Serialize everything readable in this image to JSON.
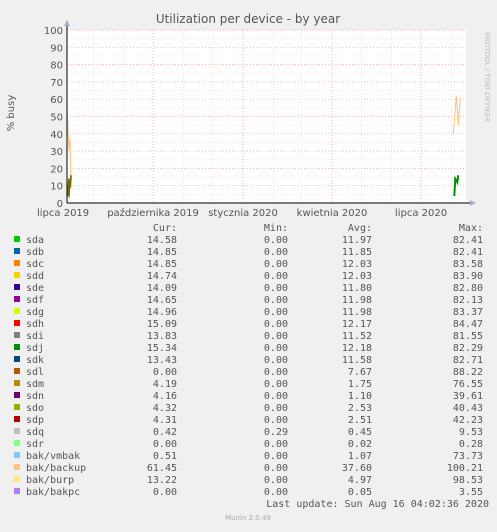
{
  "chart_data": {
    "type": "line",
    "title": "Utilization per device - by year",
    "ylabel": "% busy",
    "side_label": "RRDTOOL / TOBI OETIKER",
    "ylim": [
      0,
      100
    ],
    "yticks": [
      0,
      10,
      20,
      30,
      40,
      50,
      60,
      70,
      80,
      90,
      100
    ],
    "xlim": [
      "2019-07-05",
      "2020-08-16"
    ],
    "xticks": [
      {
        "label": "lipca 2019",
        "date": "2019-07-01"
      },
      {
        "label": "października 2019",
        "date": "2019-10-01"
      },
      {
        "label": "stycznia 2020",
        "date": "2020-01-01"
      },
      {
        "label": "kwietnia 2020",
        "date": "2020-04-01"
      },
      {
        "label": "lipca 2020",
        "date": "2020-07-01"
      }
    ],
    "grid": true,
    "columns": [
      "Cur:",
      "Min:",
      "Avg:",
      "Max:"
    ],
    "series": [
      {
        "name": "sda",
        "color": "#00cc00",
        "cur": "14.58",
        "min": "0.00",
        "avg": "11.97",
        "max": "82.41"
      },
      {
        "name": "sdb",
        "color": "#0066b3",
        "cur": "14.85",
        "min": "0.00",
        "avg": "11.85",
        "max": "82.41"
      },
      {
        "name": "sdc",
        "color": "#ff8000",
        "cur": "14.85",
        "min": "0.00",
        "avg": "12.03",
        "max": "83.58"
      },
      {
        "name": "sdd",
        "color": "#ffcc00",
        "cur": "14.74",
        "min": "0.00",
        "avg": "12.03",
        "max": "83.90"
      },
      {
        "name": "sde",
        "color": "#330099",
        "cur": "14.09",
        "min": "0.00",
        "avg": "11.80",
        "max": "82.80"
      },
      {
        "name": "sdf",
        "color": "#990099",
        "cur": "14.65",
        "min": "0.00",
        "avg": "11.98",
        "max": "82.13"
      },
      {
        "name": "sdg",
        "color": "#ccff00",
        "cur": "14.96",
        "min": "0.00",
        "avg": "11.98",
        "max": "83.37"
      },
      {
        "name": "sdh",
        "color": "#ff0000",
        "cur": "15.09",
        "min": "0.00",
        "avg": "12.17",
        "max": "84.47"
      },
      {
        "name": "sdi",
        "color": "#808080",
        "cur": "13.83",
        "min": "0.00",
        "avg": "11.52",
        "max": "81.55"
      },
      {
        "name": "sdj",
        "color": "#008f00",
        "cur": "15.34",
        "min": "0.00",
        "avg": "12.18",
        "max": "82.29"
      },
      {
        "name": "sdk",
        "color": "#00487d",
        "cur": "13.43",
        "min": "0.00",
        "avg": "11.58",
        "max": "82.71"
      },
      {
        "name": "sdl",
        "color": "#b35a00",
        "cur": "0.00",
        "min": "0.00",
        "avg": "7.67",
        "max": "88.22"
      },
      {
        "name": "sdm",
        "color": "#b38f00",
        "cur": "4.19",
        "min": "0.00",
        "avg": "1.75",
        "max": "76.55"
      },
      {
        "name": "sdn",
        "color": "#6b006b",
        "cur": "4.16",
        "min": "0.00",
        "avg": "1.10",
        "max": "39.61"
      },
      {
        "name": "sdo",
        "color": "#8fb300",
        "cur": "4.32",
        "min": "0.00",
        "avg": "2.53",
        "max": "40.43"
      },
      {
        "name": "sdp",
        "color": "#b30000",
        "cur": "4.31",
        "min": "0.00",
        "avg": "2.51",
        "max": "42.23"
      },
      {
        "name": "sdq",
        "color": "#bebebe",
        "cur": "0.42",
        "min": "0.29",
        "avg": "0.45",
        "max": "9.53"
      },
      {
        "name": "sdr",
        "color": "#80ff80",
        "cur": "0.00",
        "min": "0.00",
        "avg": "0.02",
        "max": "0.28"
      },
      {
        "name": "bak/vmbak",
        "color": "#80c9ff",
        "cur": "0.51",
        "min": "0.00",
        "avg": "1.07",
        "max": "73.73"
      },
      {
        "name": "bak/backup",
        "color": "#ffc080",
        "cur": "61.45",
        "min": "0.00",
        "avg": "37.60",
        "max": "100.21"
      },
      {
        "name": "bak/burp",
        "color": "#ffe680",
        "cur": "13.22",
        "min": "0.00",
        "avg": "4.97",
        "max": "98.53"
      },
      {
        "name": "bak/bakpc",
        "color": "#aa80ff",
        "cur": "0.00",
        "min": "0.00",
        "avg": "0.05",
        "max": "3.55"
      }
    ]
  },
  "last_update": "Last update: Sun Aug 16 04:02:36 2020",
  "footer": "Munin 2.0.49"
}
